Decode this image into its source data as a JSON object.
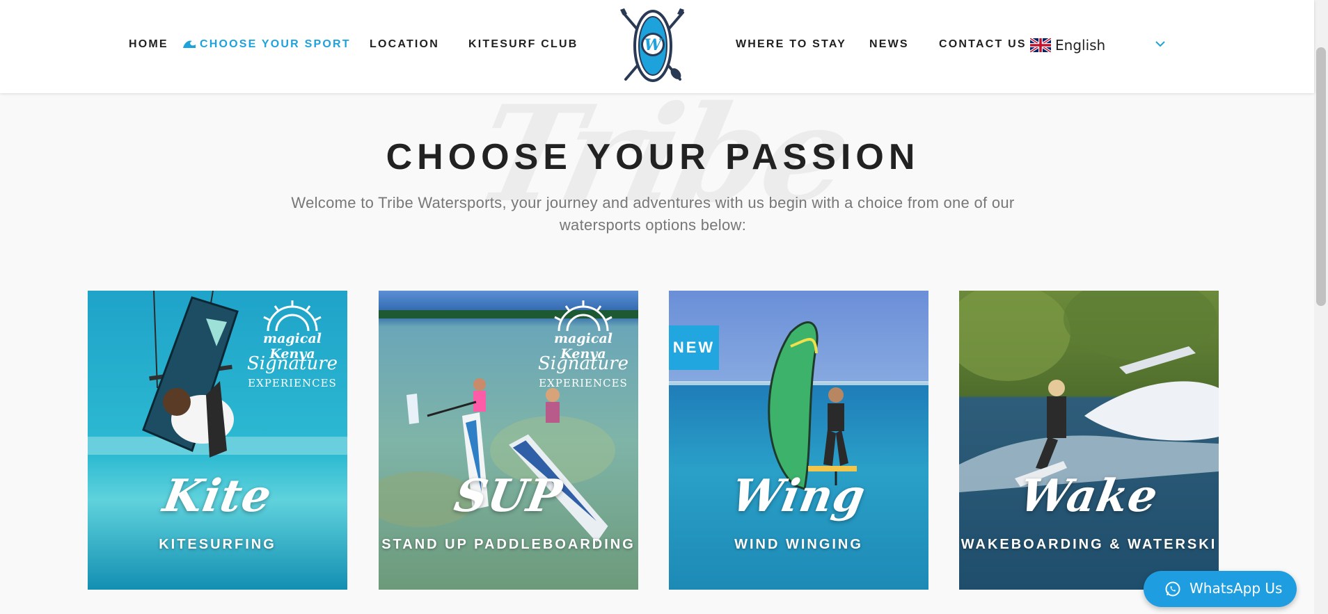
{
  "nav": {
    "left_items": [
      "HOME",
      "CHOOSE YOUR SPORT",
      "LOCATION",
      "KITESURF CLUB"
    ],
    "right_items": [
      "WHERE TO STAY",
      "NEWS",
      "CONTACT US"
    ],
    "active_item": "CHOOSE YOUR SPORT",
    "language": "English",
    "accent_color": "#1ea2dc"
  },
  "hero": {
    "watermark": "Tribe",
    "title": "CHOOSE YOUR PASSION",
    "intro": "Welcome to Tribe Watersports, your journey and adventures with us begin with a choice from one of our watersports options below:"
  },
  "cards": [
    {
      "script": "Kite",
      "label": "KITESURFING",
      "badge": "",
      "brand": {
        "top": "magical Kenya",
        "signature": "Signature",
        "experiences": "EXPERIENCES"
      }
    },
    {
      "script": "SUP",
      "label": "STAND UP PADDLEBOARDING",
      "badge": "",
      "brand": {
        "top": "magical Kenya",
        "signature": "Signature",
        "experiences": "EXPERIENCES"
      }
    },
    {
      "script": "Wing",
      "label": "WIND WINGING",
      "badge": "NEW"
    },
    {
      "script": "Wake",
      "label": "WAKEBOARDING & WATERSKI",
      "badge": ""
    }
  ],
  "whatsapp": {
    "label": "WhatsApp Us",
    "color": "#1e9ee0"
  }
}
